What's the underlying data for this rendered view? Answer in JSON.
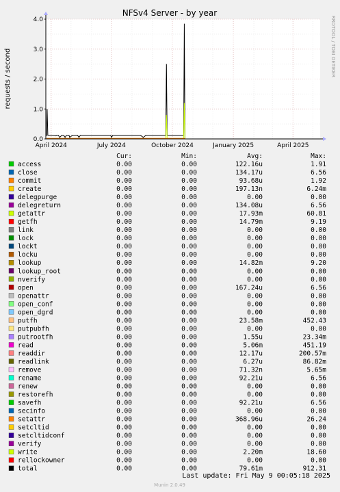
{
  "chart_data": {
    "type": "line",
    "title": "NFSv4 Server - by year",
    "ylabel": "requests / second",
    "watermark": "RRDTOOL / TOBI OETIKER",
    "ylim": [
      0,
      4.0
    ],
    "y_ticks": [
      "0.0",
      "1.0",
      "2.0",
      "3.0",
      "4.0"
    ],
    "x_ticks": [
      {
        "label": "April 2024",
        "date": "2024-04-01"
      },
      {
        "label": "July 2024",
        "date": "2024-07-01"
      },
      {
        "label": "October 2024",
        "date": "2024-10-01"
      },
      {
        "label": "January 2025",
        "date": "2025-01-01"
      },
      {
        "label": "April 2025",
        "date": "2025-04-01"
      }
    ],
    "grid": true,
    "series": [
      {
        "name": "total",
        "color": "#000000",
        "points": [
          [
            "2024-03-25",
            0.1
          ],
          [
            "2024-03-26",
            1.0
          ],
          [
            "2024-03-27",
            0.12
          ],
          [
            "2024-04-03",
            0.12
          ],
          [
            "2024-04-08",
            0.1
          ],
          [
            "2024-04-09",
            0.12
          ],
          [
            "2024-04-12",
            0.12
          ],
          [
            "2024-04-14",
            0.05
          ],
          [
            "2024-04-17",
            0.12
          ],
          [
            "2024-04-20",
            0.12
          ],
          [
            "2024-04-22",
            0.05
          ],
          [
            "2024-04-24",
            0.12
          ],
          [
            "2024-04-28",
            0.12
          ],
          [
            "2024-04-29",
            0.05
          ],
          [
            "2024-05-03",
            0.12
          ],
          [
            "2024-05-11",
            0.12
          ],
          [
            "2024-05-13",
            0.05
          ],
          [
            "2024-05-15",
            0.12
          ],
          [
            "2024-06-30",
            0.12
          ],
          [
            "2024-07-01",
            0.05
          ],
          [
            "2024-07-03",
            0.12
          ],
          [
            "2024-08-14",
            0.12
          ],
          [
            "2024-08-18",
            0.05
          ],
          [
            "2024-08-22",
            0.12
          ],
          [
            "2024-09-21",
            0.12
          ],
          [
            "2024-09-22",
            2.5
          ],
          [
            "2024-09-23",
            0.12
          ],
          [
            "2024-10-18",
            0.12
          ],
          [
            "2024-10-19",
            3.85
          ],
          [
            "2024-10-20",
            0.0
          ],
          [
            "2025-05-08",
            0.0
          ]
        ]
      },
      {
        "name": "write",
        "color": "#ccff00",
        "points": [
          [
            "2024-09-21",
            0.0
          ],
          [
            "2024-09-22",
            0.8
          ],
          [
            "2024-09-23",
            0.0
          ],
          [
            "2024-10-18",
            0.0
          ],
          [
            "2024-10-19",
            1.2
          ],
          [
            "2024-10-20",
            0.0
          ]
        ]
      },
      {
        "name": "commit",
        "color": "#ff8000",
        "points": [
          [
            "2024-03-25",
            0.02
          ],
          [
            "2024-10-20",
            0.02
          ]
        ]
      }
    ],
    "legend_header": {
      "cur": "Cur:",
      "min": "Min:",
      "avg": "Avg:",
      "max": "Max:"
    },
    "legend": [
      {
        "name": "access",
        "color": "#00cc00",
        "cur": "0.00",
        "min": "0.00",
        "avg": "122.16u",
        "max": "1.91"
      },
      {
        "name": "close",
        "color": "#0066b3",
        "cur": "0.00",
        "min": "0.00",
        "avg": "134.17u",
        "max": "6.56"
      },
      {
        "name": "commit",
        "color": "#ff8000",
        "cur": "0.00",
        "min": "0.00",
        "avg": "93.68u",
        "max": "1.92"
      },
      {
        "name": "create",
        "color": "#ffcc00",
        "cur": "0.00",
        "min": "0.00",
        "avg": "197.13n",
        "max": "6.24m"
      },
      {
        "name": "delegpurge",
        "color": "#330099",
        "cur": "0.00",
        "min": "0.00",
        "avg": "0.00",
        "max": "0.00"
      },
      {
        "name": "delegreturn",
        "color": "#990099",
        "cur": "0.00",
        "min": "0.00",
        "avg": "134.08u",
        "max": "6.56"
      },
      {
        "name": "getattr",
        "color": "#ccff00",
        "cur": "0.00",
        "min": "0.00",
        "avg": "17.93m",
        "max": "60.81"
      },
      {
        "name": "getfh",
        "color": "#ff0000",
        "cur": "0.00",
        "min": "0.00",
        "avg": "14.79m",
        "max": "9.19"
      },
      {
        "name": "link",
        "color": "#808080",
        "cur": "0.00",
        "min": "0.00",
        "avg": "0.00",
        "max": "0.00"
      },
      {
        "name": "lock",
        "color": "#008f00",
        "cur": "0.00",
        "min": "0.00",
        "avg": "0.00",
        "max": "0.00"
      },
      {
        "name": "lockt",
        "color": "#00487d",
        "cur": "0.00",
        "min": "0.00",
        "avg": "0.00",
        "max": "0.00"
      },
      {
        "name": "locku",
        "color": "#b35a00",
        "cur": "0.00",
        "min": "0.00",
        "avg": "0.00",
        "max": "0.00"
      },
      {
        "name": "lookup",
        "color": "#b38f00",
        "cur": "0.00",
        "min": "0.00",
        "avg": "14.82m",
        "max": "9.20"
      },
      {
        "name": "lookup_root",
        "color": "#6b006b",
        "cur": "0.00",
        "min": "0.00",
        "avg": "0.00",
        "max": "0.00"
      },
      {
        "name": "nverify",
        "color": "#8fb300",
        "cur": "0.00",
        "min": "0.00",
        "avg": "0.00",
        "max": "0.00"
      },
      {
        "name": "open",
        "color": "#b30000",
        "cur": "0.00",
        "min": "0.00",
        "avg": "167.24u",
        "max": "6.56"
      },
      {
        "name": "openattr",
        "color": "#bebebe",
        "cur": "0.00",
        "min": "0.00",
        "avg": "0.00",
        "max": "0.00"
      },
      {
        "name": "open_conf",
        "color": "#80ff80",
        "cur": "0.00",
        "min": "0.00",
        "avg": "0.00",
        "max": "0.00"
      },
      {
        "name": "open_dgrd",
        "color": "#80c9ff",
        "cur": "0.00",
        "min": "0.00",
        "avg": "0.00",
        "max": "0.00"
      },
      {
        "name": "putfh",
        "color": "#ffc080",
        "cur": "0.00",
        "min": "0.00",
        "avg": "23.58m",
        "max": "452.43"
      },
      {
        "name": "putpubfh",
        "color": "#ffe680",
        "cur": "0.00",
        "min": "0.00",
        "avg": "0.00",
        "max": "0.00"
      },
      {
        "name": "putrootfh",
        "color": "#aa80ff",
        "cur": "0.00",
        "min": "0.00",
        "avg": "1.55u",
        "max": "23.34m"
      },
      {
        "name": "read",
        "color": "#ee00cc",
        "cur": "0.00",
        "min": "0.00",
        "avg": "5.06m",
        "max": "451.19"
      },
      {
        "name": "readdir",
        "color": "#ff8080",
        "cur": "0.00",
        "min": "0.00",
        "avg": "12.17u",
        "max": "200.57m"
      },
      {
        "name": "readlink",
        "color": "#666600",
        "cur": "0.00",
        "min": "0.00",
        "avg": "6.27u",
        "max": "86.82m"
      },
      {
        "name": "remove",
        "color": "#ffbfff",
        "cur": "0.00",
        "min": "0.00",
        "avg": "71.32n",
        "max": "5.65m"
      },
      {
        "name": "rename",
        "color": "#00ffcc",
        "cur": "0.00",
        "min": "0.00",
        "avg": "92.21u",
        "max": "6.56"
      },
      {
        "name": "renew",
        "color": "#cc6699",
        "cur": "0.00",
        "min": "0.00",
        "avg": "0.00",
        "max": "0.00"
      },
      {
        "name": "restorefh",
        "color": "#999900",
        "cur": "0.00",
        "min": "0.00",
        "avg": "0.00",
        "max": "0.00"
      },
      {
        "name": "savefh",
        "color": "#00cc00",
        "cur": "0.00",
        "min": "0.00",
        "avg": "92.21u",
        "max": "6.56"
      },
      {
        "name": "secinfo",
        "color": "#0066b3",
        "cur": "0.00",
        "min": "0.00",
        "avg": "0.00",
        "max": "0.00"
      },
      {
        "name": "setattr",
        "color": "#ff8000",
        "cur": "0.00",
        "min": "0.00",
        "avg": "368.96u",
        "max": "26.24"
      },
      {
        "name": "setcltid",
        "color": "#ffcc00",
        "cur": "0.00",
        "min": "0.00",
        "avg": "0.00",
        "max": "0.00"
      },
      {
        "name": "setcltidconf",
        "color": "#330099",
        "cur": "0.00",
        "min": "0.00",
        "avg": "0.00",
        "max": "0.00"
      },
      {
        "name": "verify",
        "color": "#990099",
        "cur": "0.00",
        "min": "0.00",
        "avg": "0.00",
        "max": "0.00"
      },
      {
        "name": "write",
        "color": "#ccff00",
        "cur": "0.00",
        "min": "0.00",
        "avg": "2.20m",
        "max": "18.60"
      },
      {
        "name": "rellockowner",
        "color": "#ff0000",
        "cur": "0.00",
        "min": "0.00",
        "avg": "0.00",
        "max": "0.00"
      },
      {
        "name": "total",
        "color": "#000000",
        "cur": "0.00",
        "min": "0.00",
        "avg": "79.61m",
        "max": "912.31"
      }
    ],
    "last_update": "Last update: Fri May  9 00:05:18 2025",
    "footer": "Munin 2.0.49"
  }
}
